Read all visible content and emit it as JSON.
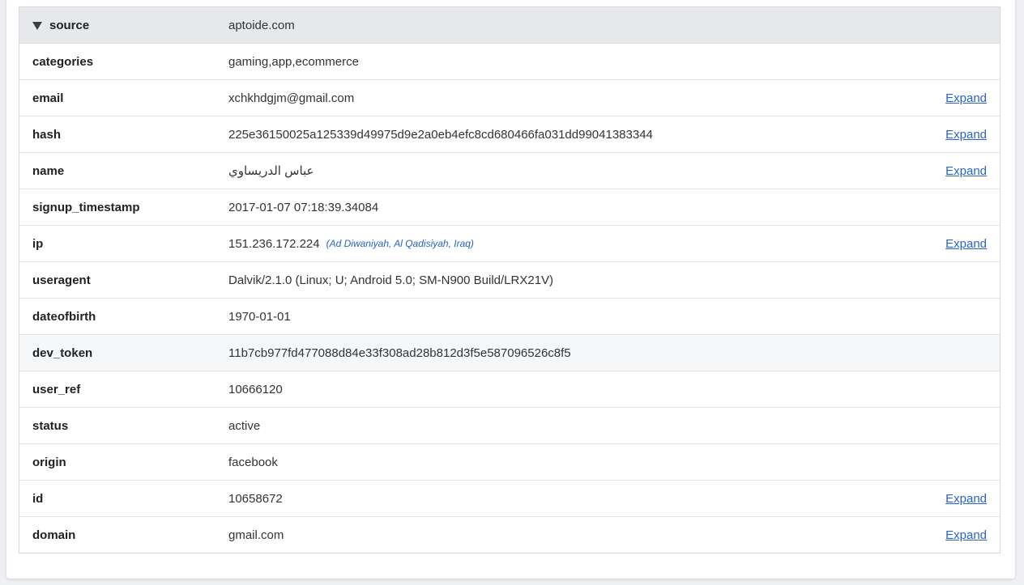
{
  "expand_label": "Expand",
  "rows": [
    {
      "key": "source",
      "value": "aptoide.com"
    },
    {
      "key": "categories",
      "value": "gaming,app,ecommerce"
    },
    {
      "key": "email",
      "value": "xchkhdgjm@gmail.com"
    },
    {
      "key": "hash",
      "value": "225e36150025a125339d49975d9e2a0eb4efc8cd680466fa031dd99041383344"
    },
    {
      "key": "name",
      "value": "عباس الدريساوي"
    },
    {
      "key": "signup_timestamp",
      "value": "2017-01-07 07:18:39.34084"
    },
    {
      "key": "ip",
      "value": "151.236.172.224",
      "geo": "(Ad Diwaniyah, Al Qadisiyah, Iraq)"
    },
    {
      "key": "useragent",
      "value": "Dalvik/2.1.0 (Linux; U; Android 5.0; SM-N900 Build/LRX21V)"
    },
    {
      "key": "dateofbirth",
      "value": "1970-01-01"
    },
    {
      "key": "dev_token",
      "value": "11b7cb977fd477088d84e33f308ad28b812d3f5e587096526c8f5"
    },
    {
      "key": "user_ref",
      "value": "10666120"
    },
    {
      "key": "status",
      "value": "active"
    },
    {
      "key": "origin",
      "value": "facebook"
    },
    {
      "key": "id",
      "value": "10658672"
    },
    {
      "key": "domain",
      "value": "gmail.com"
    }
  ],
  "colors": {
    "link": "#2a63c7",
    "header_bg": "#e6e8ec",
    "hover_bg": "#f6f7f9",
    "page_bg": "#eef0f3"
  },
  "icons": {
    "collapse": "triangle-down-icon"
  }
}
